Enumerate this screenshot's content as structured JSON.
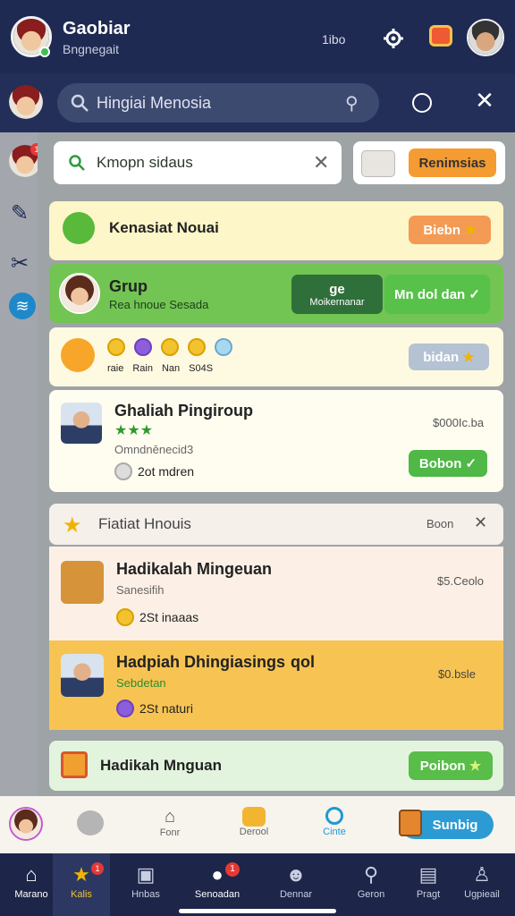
{
  "header": {
    "title": "Gaobiar",
    "subtitle": "Bngnegait",
    "status": "1ibo",
    "settings_icon": "gear-icon",
    "notification_icon": "gift-icon"
  },
  "search": {
    "value": "Hingiai Menosia",
    "mic_icon": "voice-icon",
    "history_icon": "clock-icon",
    "close_icon": "close-icon"
  },
  "filter": {
    "value": "Kmopn sidaus",
    "action_label": "Renimsias"
  },
  "sidebar": [
    {
      "name": "avatar-badge",
      "badge": "1"
    },
    {
      "name": "wrench-icon"
    },
    {
      "name": "tools-icon"
    },
    {
      "name": "wifi-icon"
    }
  ],
  "cards": {
    "top": {
      "title": "Kenasiat Nouai",
      "button": "Biebn"
    },
    "group": {
      "title": "Grup",
      "subtitle": "Rea hnoue Sesada",
      "left_label": "Moikernanar",
      "left_big": "ge",
      "right_label": "Mn dol dan"
    },
    "emoji": {
      "labels": [
        "raie",
        "Rain",
        "Nan",
        "S04S"
      ],
      "button": "bidan"
    },
    "gift": {
      "title": "Ghaliah Pingiroup",
      "sub": "Omndnēnecid3",
      "coins": "2ot mdren",
      "price": "$000Ic.ba",
      "button": "Bobon"
    },
    "section": {
      "title": "Fiatiat Hnouis",
      "right": "Boon"
    },
    "list": [
      {
        "title": "Hadikalah Mingeuan",
        "sub": "Sanesifih",
        "coins": "2St inaaas",
        "price": "$5.Ceolo"
      },
      {
        "title": "Hadpiah Dhingiasings",
        "sub": "Sebdetan",
        "coins": "2St naturi",
        "price": "$0.bsle",
        "extra": "qol"
      }
    ],
    "footer": {
      "title": "Hadikah Mnguan",
      "button": "Poibon"
    }
  },
  "bottom": {
    "items": [
      {
        "label": "Fonr"
      },
      {
        "label": "Derool"
      },
      {
        "label": "Cinte"
      }
    ],
    "button": "Sunbig"
  },
  "nav": [
    {
      "label": "Marano"
    },
    {
      "label": "Kalis",
      "badge": "1"
    },
    {
      "label": "Hnbas"
    },
    {
      "label": "Senoadan",
      "badge": "1"
    },
    {
      "label": "Dennar"
    },
    {
      "label": "Geron"
    },
    {
      "label": "Pragt"
    },
    {
      "label": "Ugpieail"
    }
  ],
  "colors": {
    "accent_green": "#52b84a",
    "accent_orange": "#f39a3b",
    "dark_nav": "#1d2548"
  }
}
